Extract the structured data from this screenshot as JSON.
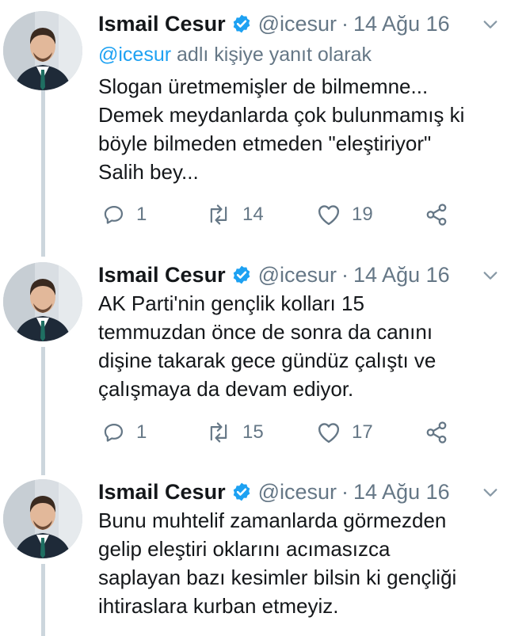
{
  "colors": {
    "name": "#14171a",
    "meta": "#657786",
    "accent": "#1da1f2",
    "thread_line": "#ccd6dd"
  },
  "tweets": [
    {
      "name": "Ismail Cesur",
      "handle": "@icesur",
      "separator": "·",
      "date": "14 Ağu 16",
      "reply": {
        "mention": "@icesur",
        "suffix": " adlı kişiye yanıt olarak"
      },
      "lines": [
        "Slogan üretmemişler de bilmemne...",
        "Demek meydanlarda çok bulunmamış ki",
        "böyle bilmeden etmeden \"eleştiriyor\"",
        "Salih bey..."
      ],
      "replies": "1",
      "retweets": "14",
      "likes": "19"
    },
    {
      "name": "Ismail Cesur",
      "handle": "@icesur",
      "separator": "·",
      "date": "14 Ağu 16",
      "lines": [
        "AK Parti'nin gençlik kolları 15",
        "temmuzdan önce de sonra da canını",
        "dişine takarak gece gündüz çalıştı ve",
        "çalışmaya da devam ediyor."
      ],
      "replies": "1",
      "retweets": "15",
      "likes": "17"
    },
    {
      "name": "Ismail Cesur",
      "handle": "@icesur",
      "separator": "·",
      "date": "14 Ağu 16",
      "lines": [
        "Bunu muhtelif zamanlarda görmezden",
        "gelip eleştiri oklarını acımasızca",
        "saplayan bazı kesimler bilsin ki gençliği",
        "ihtiraslara kurban etmeyiz."
      ]
    }
  ]
}
